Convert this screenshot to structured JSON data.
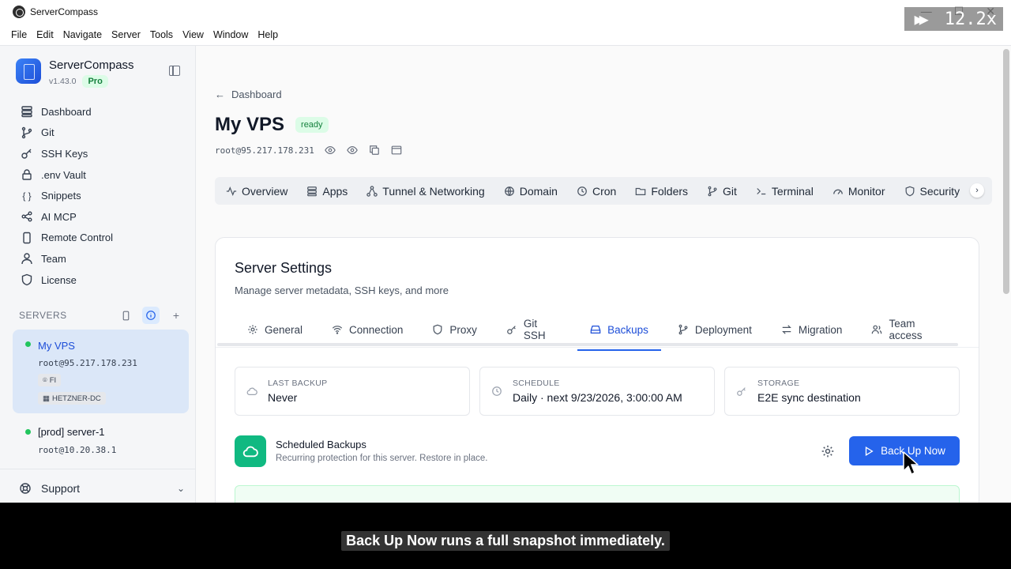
{
  "window": {
    "title": "ServerCompass",
    "speed_indicator": "12.2x"
  },
  "menu": [
    "File",
    "Edit",
    "Navigate",
    "Server",
    "Tools",
    "View",
    "Window",
    "Help"
  ],
  "brand": {
    "name": "ServerCompass",
    "version": "v1.43.0",
    "plan": "Pro"
  },
  "nav": [
    {
      "label": "Dashboard",
      "icon": "dashboard-icon"
    },
    {
      "label": "Git",
      "icon": "git-branch-icon"
    },
    {
      "label": "SSH Keys",
      "icon": "key-icon"
    },
    {
      "label": ".env Vault",
      "icon": "lock-icon"
    },
    {
      "label": "Snippets",
      "icon": "braces-icon"
    },
    {
      "label": "AI MCP",
      "icon": "share-icon"
    },
    {
      "label": "Remote Control",
      "icon": "phone-icon"
    },
    {
      "label": "Team",
      "icon": "user-icon"
    },
    {
      "label": "License",
      "icon": "shield-icon"
    }
  ],
  "servers": {
    "title": "SERVERS",
    "items": [
      {
        "name": "My VPS",
        "host": "root@95.217.178.231",
        "location": "FI",
        "datacenter": "HETZNER-DC",
        "status": "online"
      },
      {
        "name": "[prod] server-1",
        "host": "root@10.20.38.1",
        "status": "online"
      }
    ]
  },
  "support": {
    "label": "Support"
  },
  "breadcrumb": {
    "label": "Dashboard"
  },
  "server": {
    "title": "My VPS",
    "status": "ready",
    "host": "root@95.217.178.231"
  },
  "tabs": [
    "Overview",
    "Apps",
    "Tunnel & Networking",
    "Domain",
    "Cron",
    "Folders",
    "Git",
    "Terminal",
    "Monitor",
    "Security"
  ],
  "settings": {
    "title": "Server Settings",
    "subtitle": "Manage server metadata, SSH keys, and more",
    "tabs": [
      "General",
      "Connection",
      "Proxy",
      "Git SSH",
      "Backups",
      "Deployment",
      "Migration",
      "Team access"
    ],
    "active_tab": "Backups"
  },
  "stats": [
    {
      "label": "LAST BACKUP",
      "value": "Never"
    },
    {
      "label": "SCHEDULE",
      "value": "Daily · next 9/23/2026, 3:00:00 AM"
    },
    {
      "label": "STORAGE",
      "value": "E2E sync destination"
    }
  ],
  "scheduled": {
    "title": "Scheduled Backups",
    "subtitle": "Recurring protection for this server. Restore in place.",
    "action": "Back Up Now"
  },
  "caption": "Back Up Now runs a full snapshot immediately.",
  "colors": {
    "accent": "#2563eb",
    "success": "#22c55e",
    "backup_icon_bg": "#10b981"
  }
}
